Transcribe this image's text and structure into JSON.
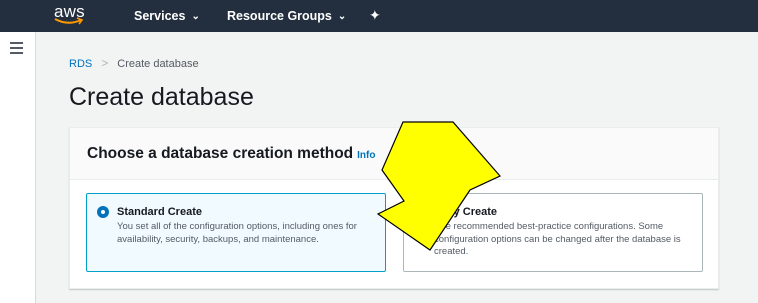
{
  "header": {
    "logo_text": "aws",
    "services_label": "Services",
    "resource_groups_label": "Resource Groups",
    "chevron": "⌄",
    "pin_glyph": "✦"
  },
  "breadcrumb": {
    "rds": "RDS",
    "separator": ">",
    "current": "Create database"
  },
  "page_title": "Create database",
  "panel": {
    "title": "Choose a database creation method",
    "info": "Info"
  },
  "options": [
    {
      "title": "Standard Create",
      "description": "You set all of the configuration options, including ones for availability, security, backups, and maintenance.",
      "selected": true
    },
    {
      "title": "Easy Create",
      "description": "Use recommended best-practice configurations. Some configuration options can be changed after the database is created.",
      "selected": false
    }
  ],
  "overlay": {
    "arrow_color": "#ffff00",
    "arrow_outline": "#000000"
  },
  "colors": {
    "topbar": "#232f3e",
    "link": "#0073bb",
    "selected_border": "#00a1c9",
    "selected_bg": "#f1faff"
  }
}
